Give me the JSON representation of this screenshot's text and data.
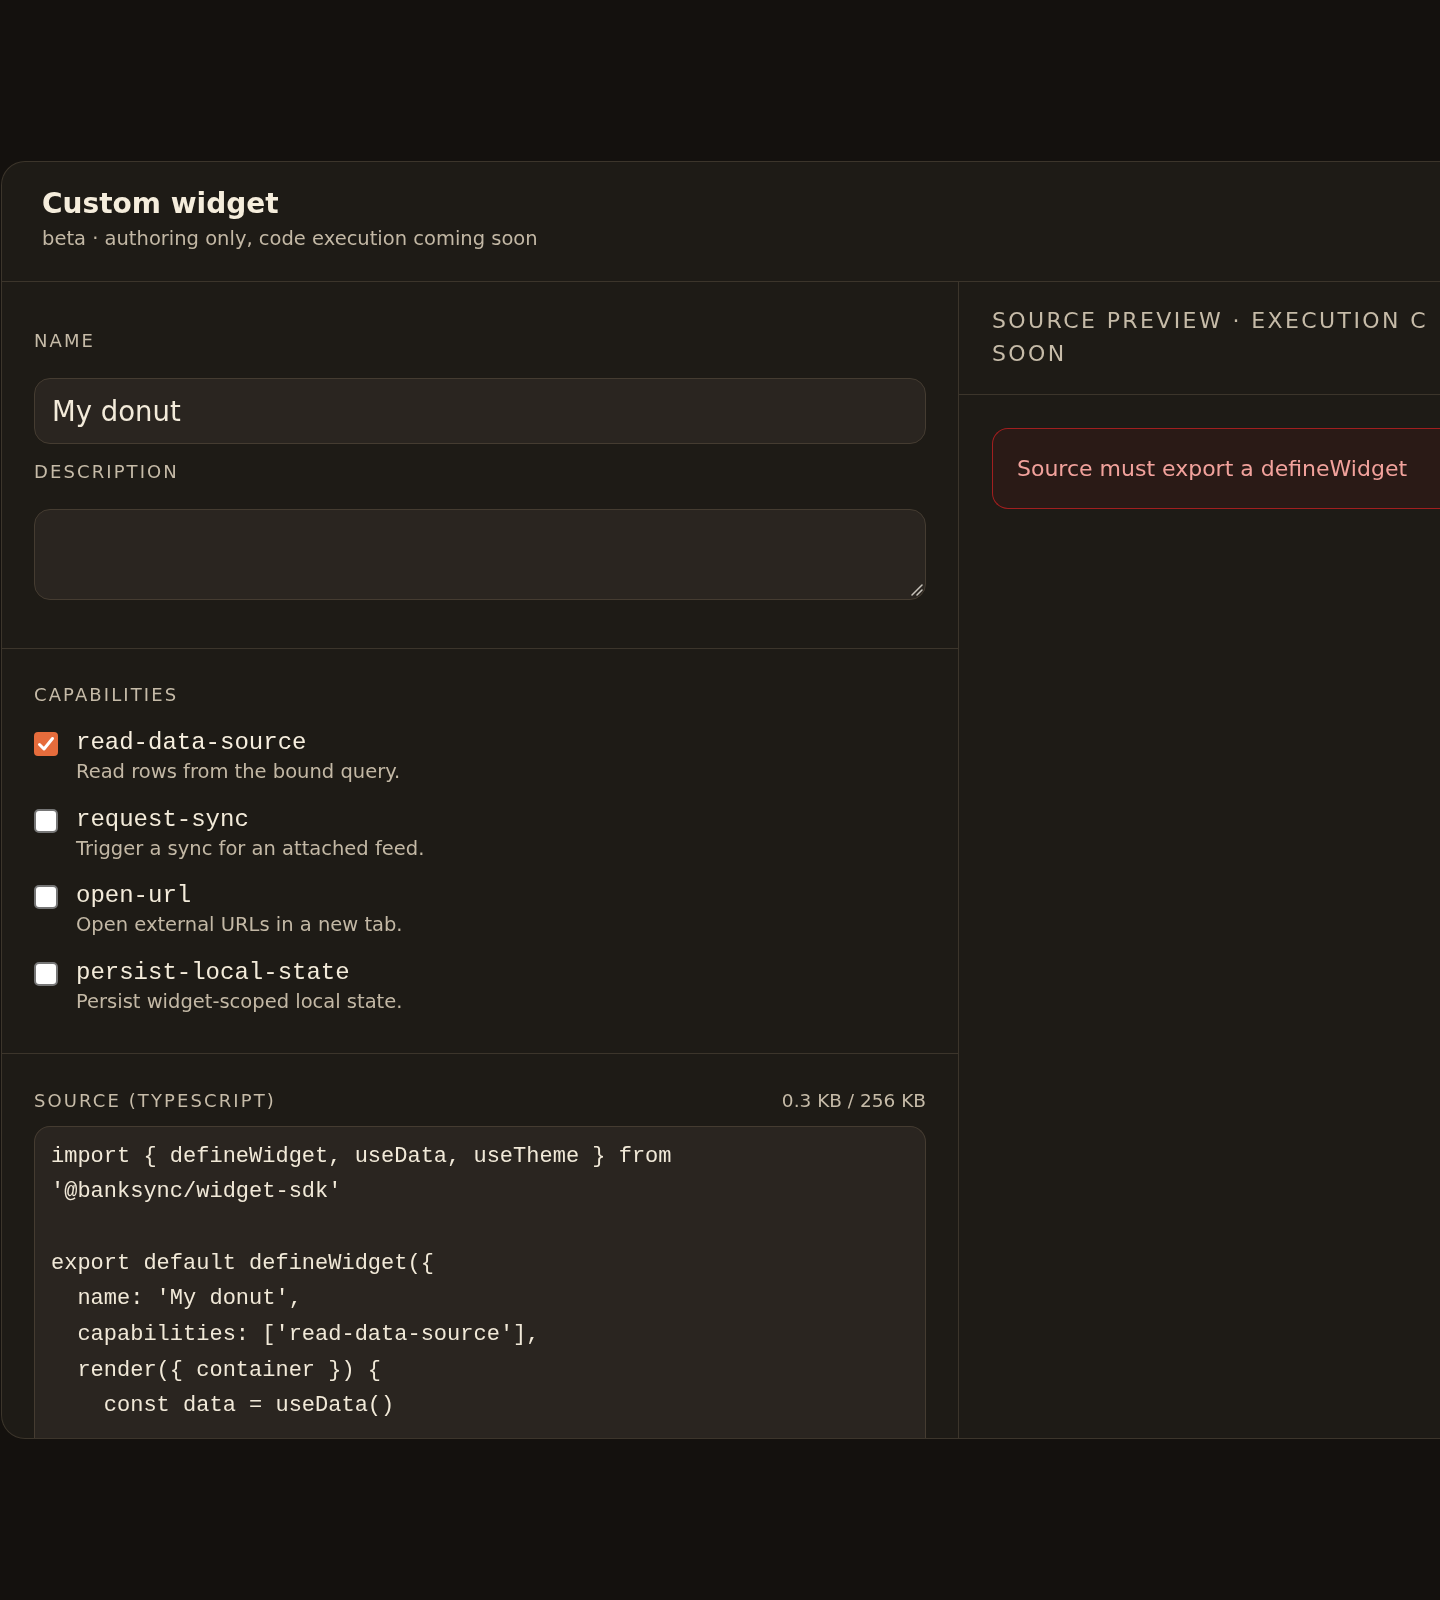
{
  "header": {
    "title": "Custom widget",
    "subtitle": "beta · authoring only, code execution coming soon"
  },
  "form": {
    "name_field": {
      "label": "NAME",
      "value": "My donut"
    },
    "description_field": {
      "label": "DESCRIPTION"
    },
    "capabilities": {
      "label": "CAPABILITIES",
      "items": [
        {
          "name": "read-data-source",
          "description": "Read rows from the bound query.",
          "checked": true
        },
        {
          "name": "request-sync",
          "description": "Trigger a sync for an attached feed.",
          "checked": false
        },
        {
          "name": "open-url",
          "description": "Open external URLs in a new tab.",
          "checked": false
        },
        {
          "name": "persist-local-state",
          "description": "Persist widget-scoped local state.",
          "checked": false
        }
      ]
    },
    "source": {
      "label": "SOURCE (TYPESCRIPT)",
      "size": "0.3 KB / 256 KB",
      "code": "import { defineWidget, useData, useTheme } from '@banksync/widget-sdk'\n\nexport default defineWidget({\n  name: 'My donut',\n  capabilities: ['read-data-source'],\n  render({ container }) {\n    const data = useData()"
    }
  },
  "preview": {
    "title": "SOURCE PREVIEW · EXECUTION C SOON",
    "error": "Source must export a defineWidget"
  }
}
